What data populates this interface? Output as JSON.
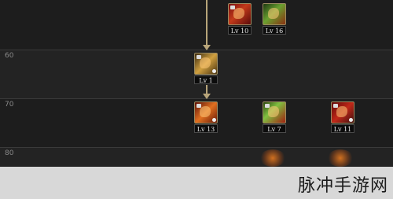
{
  "level_rows": [
    {
      "label": ""
    },
    {
      "label": "60"
    },
    {
      "label": "70"
    },
    {
      "label": "80"
    }
  ],
  "skills": [
    {
      "id": "s1",
      "level_text": "Lv 10",
      "color": "red"
    },
    {
      "id": "s2",
      "level_text": "Lv 16",
      "color": "green"
    },
    {
      "id": "s3",
      "level_text": "Lv 1",
      "color": "gold"
    },
    {
      "id": "s4",
      "level_text": "Lv 13",
      "color": "redgold"
    },
    {
      "id": "s5",
      "level_text": "Lv 7",
      "color": "greenred"
    },
    {
      "id": "s6",
      "level_text": "Lv 11",
      "color": "crimson"
    }
  ],
  "watermark": {
    "text": "脉冲手游网"
  }
}
